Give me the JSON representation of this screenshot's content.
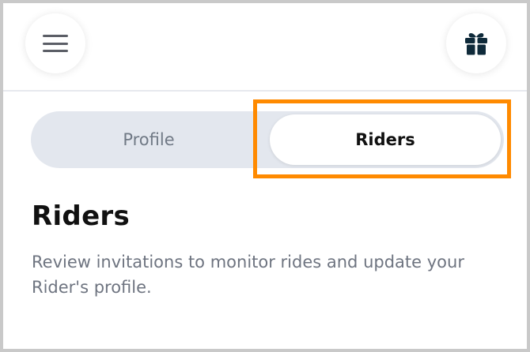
{
  "header": {
    "menu_icon": "hamburger-menu-icon",
    "gift_icon": "gift-icon"
  },
  "tabs": [
    {
      "label": "Profile",
      "selected": false
    },
    {
      "label": "Riders",
      "selected": true
    }
  ],
  "content": {
    "title": "Riders",
    "description": "Review invitations to monitor rides and update your Rider's profile."
  },
  "colors": {
    "highlight": "#ff8a00",
    "segment_bg": "#e3e7ee",
    "gift_icon": "#0f2a3a"
  }
}
